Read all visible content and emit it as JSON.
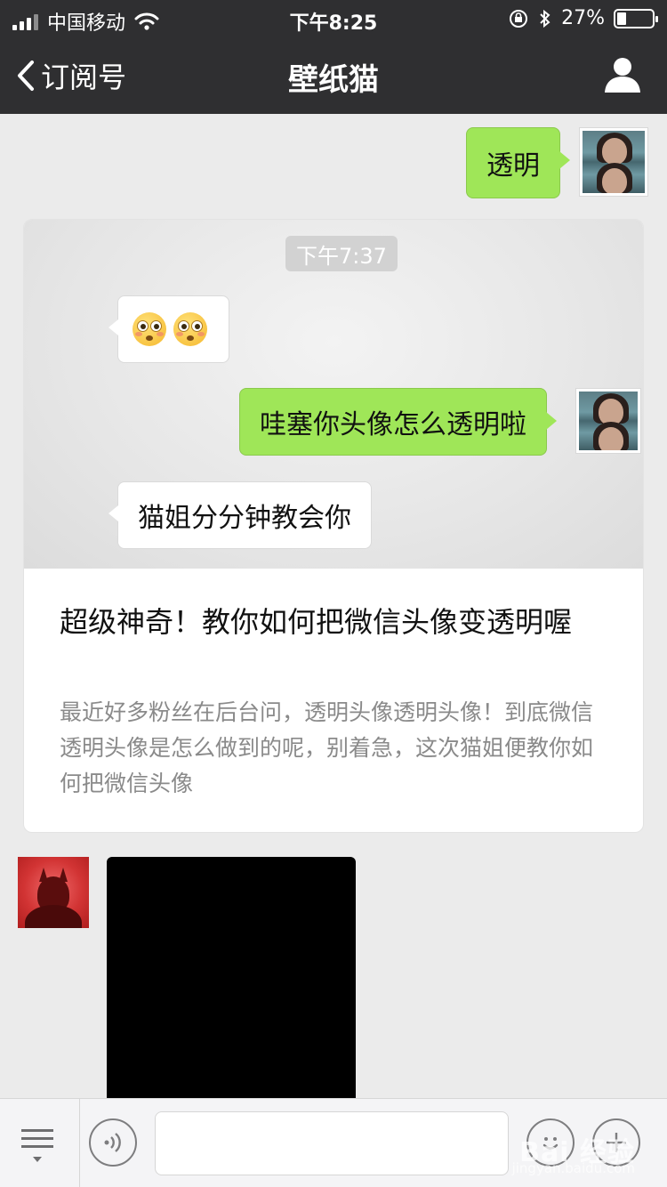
{
  "status_bar": {
    "carrier": "中国移动",
    "time": "下午8:25",
    "battery_percent": "27%",
    "battery_level": 0.27
  },
  "nav": {
    "back_label": "订阅号",
    "title": "壁纸猫",
    "profile_icon": "person-icon"
  },
  "messages": {
    "sent_top": "透明",
    "cover": {
      "time": "下午7:37",
      "emoji_reply": "flushed-face-emoji x2",
      "sent": "哇塞你头像怎么透明啦",
      "received": "猫姐分分钟教会你"
    }
  },
  "article": {
    "title": "超级神奇！教你如何把微信头像变透明喔",
    "description": "最近好多粉丝在后台问，透明头像透明头像！到底微信透明头像是怎么做到的呢，别着急，这次猫姐便教你如何把微信头像"
  },
  "input_bar": {
    "menu_icon": "menu-list-icon",
    "voice_icon": "voice-icon",
    "emoji_icon": "emoji-icon",
    "plus_icon": "plus-icon",
    "placeholder": ""
  },
  "watermark": {
    "brand": "Bai 经验",
    "sub": "jingyan.baidu.com"
  },
  "colors": {
    "nav_bg": "#2f2f31",
    "chat_bg": "#ebebeb",
    "sent_bubble": "#9fe658",
    "received_bubble": "#ffffff"
  }
}
